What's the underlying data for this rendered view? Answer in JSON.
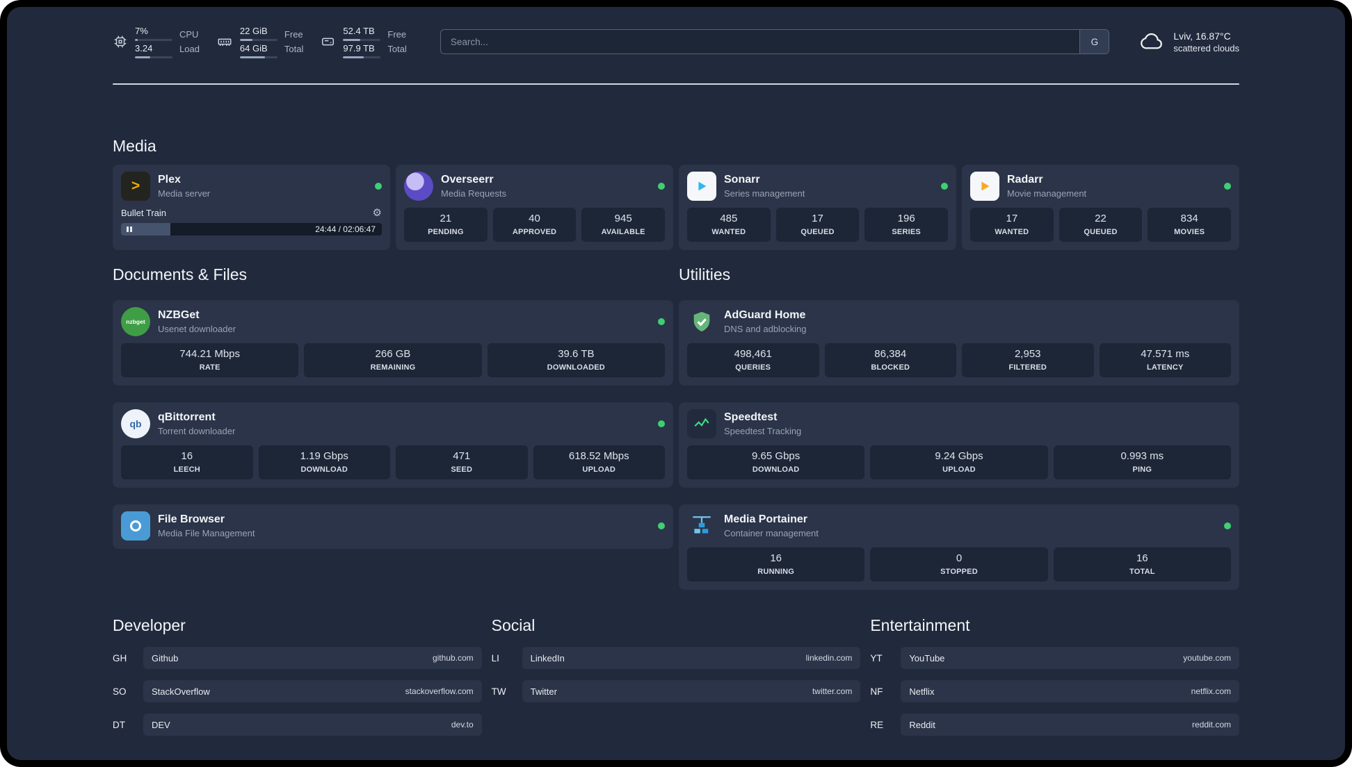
{
  "topbar": {
    "cpu": {
      "value1": "7%",
      "value2": "3.24",
      "label1": "CPU",
      "label2": "Load"
    },
    "memory": {
      "value1": "22 GiB",
      "value2": "64 GiB",
      "label1": "Free",
      "label2": "Total"
    },
    "disk": {
      "value1": "52.4 TB",
      "value2": "97.9 TB",
      "label1": "Free",
      "label2": "Total"
    },
    "search": {
      "placeholder": "Search...",
      "engine_button": "G"
    },
    "weather": {
      "location": "Lviv, 16.87°C",
      "condition": "scattered clouds"
    }
  },
  "sections": {
    "media": "Media",
    "documents": "Documents & Files",
    "utilities": "Utilities",
    "developer": "Developer",
    "social": "Social",
    "entertainment": "Entertainment"
  },
  "services": {
    "plex": {
      "name": "Plex",
      "subtitle": "Media server",
      "status": "online",
      "player": {
        "track": "Bullet Train",
        "time": "24:44 / 02:06:47"
      }
    },
    "overseerr": {
      "name": "Overseerr",
      "subtitle": "Media Requests",
      "status": "online",
      "stats": [
        {
          "value": "21",
          "label": "PENDING"
        },
        {
          "value": "40",
          "label": "APPROVED"
        },
        {
          "value": "945",
          "label": "AVAILABLE"
        }
      ]
    },
    "sonarr": {
      "name": "Sonarr",
      "subtitle": "Series management",
      "status": "online",
      "stats": [
        {
          "value": "485",
          "label": "WANTED"
        },
        {
          "value": "17",
          "label": "QUEUED"
        },
        {
          "value": "196",
          "label": "SERIES"
        }
      ]
    },
    "radarr": {
      "name": "Radarr",
      "subtitle": "Movie management",
      "status": "online",
      "stats": [
        {
          "value": "17",
          "label": "WANTED"
        },
        {
          "value": "22",
          "label": "QUEUED"
        },
        {
          "value": "834",
          "label": "MOVIES"
        }
      ]
    },
    "nzbget": {
      "name": "NZBGet",
      "subtitle": "Usenet downloader",
      "status": "online",
      "icon_text": "nzbget",
      "stats": [
        {
          "value": "744.21 Mbps",
          "label": "RATE"
        },
        {
          "value": "266 GB",
          "label": "REMAINING"
        },
        {
          "value": "39.6 TB",
          "label": "DOWNLOADED"
        }
      ]
    },
    "qbittorrent": {
      "name": "qBittorrent",
      "subtitle": "Torrent downloader",
      "status": "online",
      "icon_text": "qb",
      "stats": [
        {
          "value": "16",
          "label": "LEECH"
        },
        {
          "value": "1.19 Gbps",
          "label": "DOWNLOAD"
        },
        {
          "value": "471",
          "label": "SEED"
        },
        {
          "value": "618.52 Mbps",
          "label": "UPLOAD"
        }
      ]
    },
    "filebrowser": {
      "name": "File Browser",
      "subtitle": "Media File Management",
      "status": "online"
    },
    "adguard": {
      "name": "AdGuard Home",
      "subtitle": "DNS and adblocking",
      "stats": [
        {
          "value": "498,461",
          "label": "QUERIES"
        },
        {
          "value": "86,384",
          "label": "BLOCKED"
        },
        {
          "value": "2,953",
          "label": "FILTERED"
        },
        {
          "value": "47.571 ms",
          "label": "LATENCY"
        }
      ]
    },
    "speedtest": {
      "name": "Speedtest",
      "subtitle": "Speedtest Tracking",
      "stats": [
        {
          "value": "9.65 Gbps",
          "label": "DOWNLOAD"
        },
        {
          "value": "9.24 Gbps",
          "label": "UPLOAD"
        },
        {
          "value": "0.993 ms",
          "label": "PING"
        }
      ]
    },
    "portainer": {
      "name": "Media Portainer",
      "subtitle": "Container management",
      "status": "online",
      "stats": [
        {
          "value": "16",
          "label": "RUNNING"
        },
        {
          "value": "0",
          "label": "STOPPED"
        },
        {
          "value": "16",
          "label": "TOTAL"
        }
      ]
    }
  },
  "bookmarks": {
    "developer": [
      {
        "abbr": "GH",
        "name": "Github",
        "url": "github.com"
      },
      {
        "abbr": "SO",
        "name": "StackOverflow",
        "url": "stackoverflow.com"
      },
      {
        "abbr": "DT",
        "name": "DEV",
        "url": "dev.to"
      }
    ],
    "social": [
      {
        "abbr": "LI",
        "name": "LinkedIn",
        "url": "linkedin.com"
      },
      {
        "abbr": "TW",
        "name": "Twitter",
        "url": "twitter.com"
      }
    ],
    "entertainment": [
      {
        "abbr": "YT",
        "name": "YouTube",
        "url": "youtube.com"
      },
      {
        "abbr": "NF",
        "name": "Netflix",
        "url": "netflix.com"
      },
      {
        "abbr": "RE",
        "name": "Reddit",
        "url": "reddit.com"
      }
    ]
  },
  "colors": {
    "background": "#212a3c",
    "card": "#2b3448",
    "tile": "#1d2637",
    "status_online": "#3fcf73",
    "plex_accent": "#ebaf00",
    "adguard_green": "#67b47a",
    "speedtest_green": "#3ddc84"
  }
}
